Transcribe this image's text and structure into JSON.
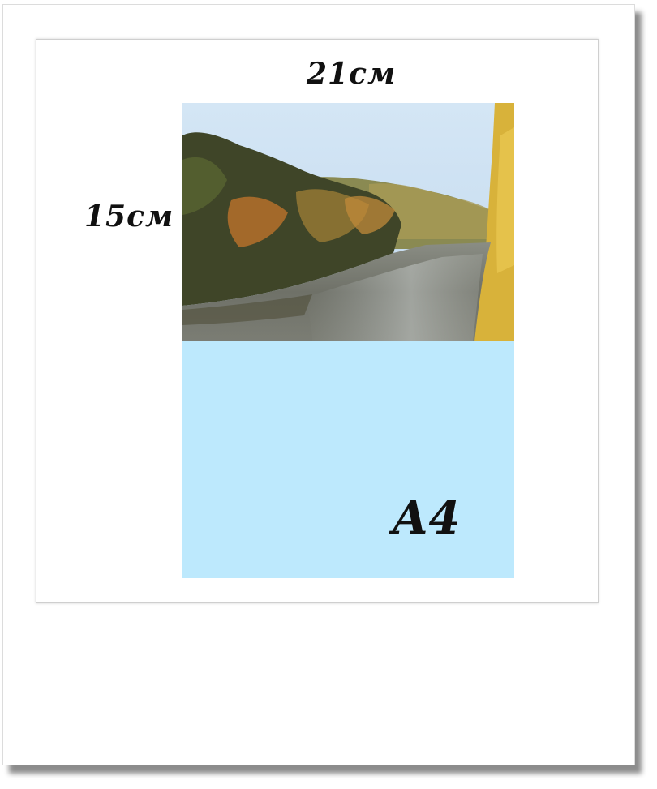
{
  "labels": {
    "width": "21см",
    "height": "15см",
    "format": "A4"
  },
  "colors": {
    "sheet": "#bde9fd",
    "sky": "#c9dff2",
    "water": "#6a6d66",
    "foliage_dark": "#3f4528",
    "foliage_autumn": "#b07a2a",
    "foliage_yellow": "#d8b23a"
  }
}
